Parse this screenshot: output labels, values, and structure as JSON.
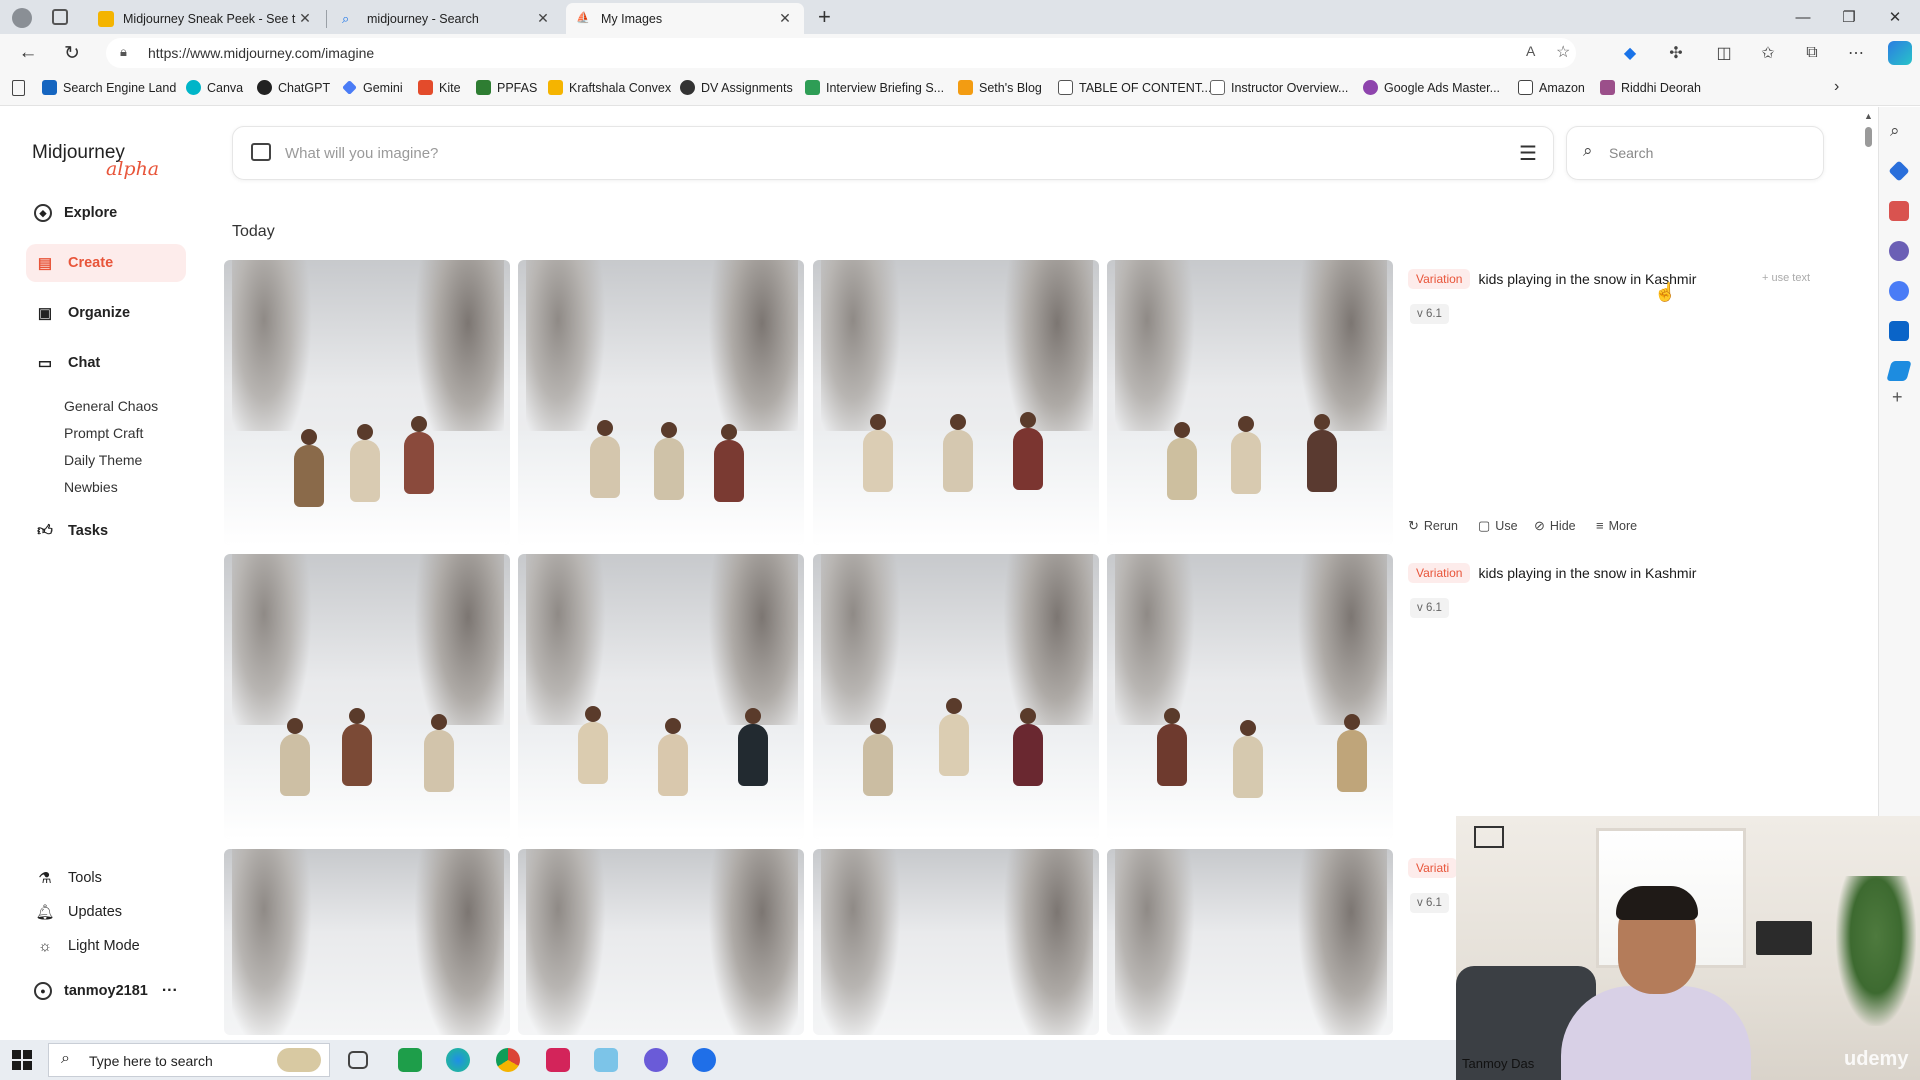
{
  "browser": {
    "tabs": [
      {
        "title": "Midjourney Sneak Peek - See the",
        "icon": "news-icon"
      },
      {
        "title": "midjourney - Search",
        "icon": "search-icon"
      },
      {
        "title": "My Images",
        "icon": "midjourney-icon"
      }
    ],
    "new_tab": "+",
    "url": "https://www.midjourney.com/imagine",
    "bookmarks": [
      {
        "label": "Search Engine Land",
        "color": "#1565c0"
      },
      {
        "label": "Canva",
        "color": "#00b5c8"
      },
      {
        "label": "ChatGPT",
        "color": "#222222"
      },
      {
        "label": "Gemini",
        "color": "#4a7cf6"
      },
      {
        "label": "Kite",
        "color": "#e34b2b"
      },
      {
        "label": "PPFAS",
        "color": "#2e7d32"
      },
      {
        "label": "Kraftshala Convex",
        "color": "#f5b400"
      },
      {
        "label": "DV Assignments",
        "color": "#333333"
      },
      {
        "label": "Interview Briefing S...",
        "color": "#2e9d55"
      },
      {
        "label": "Seth's Blog",
        "color": "#f39c12"
      },
      {
        "label": "TABLE OF CONTENT...",
        "color": "#555555"
      },
      {
        "label": "Instructor Overview...",
        "color": "#666666"
      },
      {
        "label": "Google Ads Master...",
        "color": "#8e44ad"
      },
      {
        "label": "Amazon",
        "color": "#444444"
      },
      {
        "label": "Riddhi Deorah",
        "color": "#9b4f8a"
      }
    ]
  },
  "app": {
    "logo_main": "Midjourney",
    "logo_sub": "alpha",
    "nav": [
      {
        "label": "Explore",
        "icon": "compass-icon",
        "glyph": "◎"
      },
      {
        "label": "Create",
        "icon": "brush-icon",
        "glyph": "▤"
      },
      {
        "label": "Organize",
        "icon": "image-icon",
        "glyph": "▣"
      },
      {
        "label": "Chat",
        "icon": "chat-icon",
        "glyph": "▭"
      }
    ],
    "chat_rooms": [
      "General Chaos",
      "Prompt Craft",
      "Daily Theme",
      "Newbies"
    ],
    "tasks": {
      "label": "Tasks",
      "icon": "thumbs-up-icon"
    },
    "bottom_nav": [
      {
        "label": "Tools",
        "icon": "flask-icon"
      },
      {
        "label": "Updates",
        "icon": "bell-icon"
      },
      {
        "label": "Light Mode",
        "icon": "sun-icon"
      }
    ],
    "user": {
      "name": "tanmoy2181",
      "more": "···"
    },
    "prompt_placeholder": "What will you imagine?",
    "search_placeholder": "Search",
    "section_title": "Today",
    "jobs": [
      {
        "badge": "Variation",
        "prompt": "kids playing in the snow in Kashmir",
        "version": "v 6.1",
        "use_text": "+ use text"
      },
      {
        "badge": "Variation",
        "prompt": "kids playing in the snow in Kashmir",
        "version": "v 6.1"
      },
      {
        "badge": "Variati",
        "version": "v 6.1"
      }
    ],
    "actions": [
      {
        "label": "Rerun",
        "icon": "refresh-icon"
      },
      {
        "label": "Use",
        "icon": "use-icon"
      },
      {
        "label": "Hide",
        "icon": "eye-off-icon"
      },
      {
        "label": "More",
        "icon": "menu-icon"
      }
    ]
  },
  "webcam": {
    "name": "Tanmoy Das",
    "watermark": "udemy"
  },
  "taskbar": {
    "search_placeholder": "Type here to search"
  }
}
